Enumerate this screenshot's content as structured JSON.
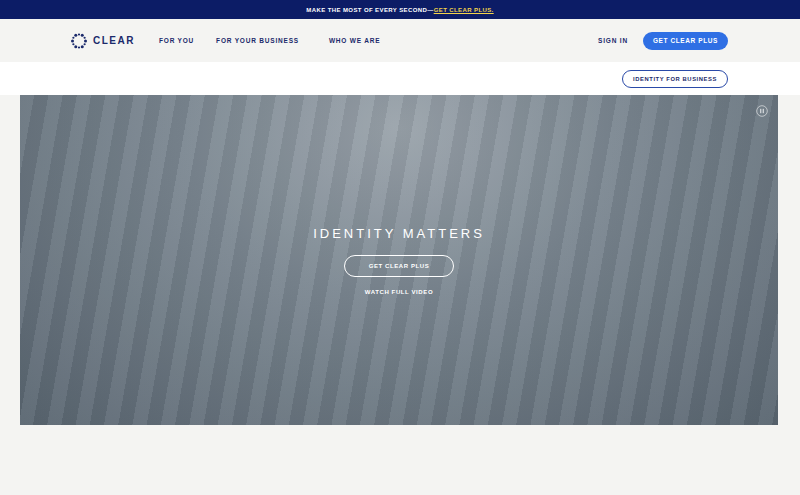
{
  "banner": {
    "text": "MAKE THE MOST OF EVERY SECOND—",
    "link": "GET CLEAR PLUS."
  },
  "nav": {
    "logo": "CLEAR",
    "links": [
      "FOR YOU",
      "FOR YOUR BUSINESS",
      "WHO WE ARE"
    ],
    "sign_in": "SIGN IN",
    "cta": "GET CLEAR PLUS"
  },
  "subnav": {
    "button": "IDENTITY FOR BUSINESS"
  },
  "hero": {
    "title": "IDENTITY MATTERS",
    "cta": "GET CLEAR PLUS",
    "video_link": "WATCH FULL VIDEO"
  }
}
